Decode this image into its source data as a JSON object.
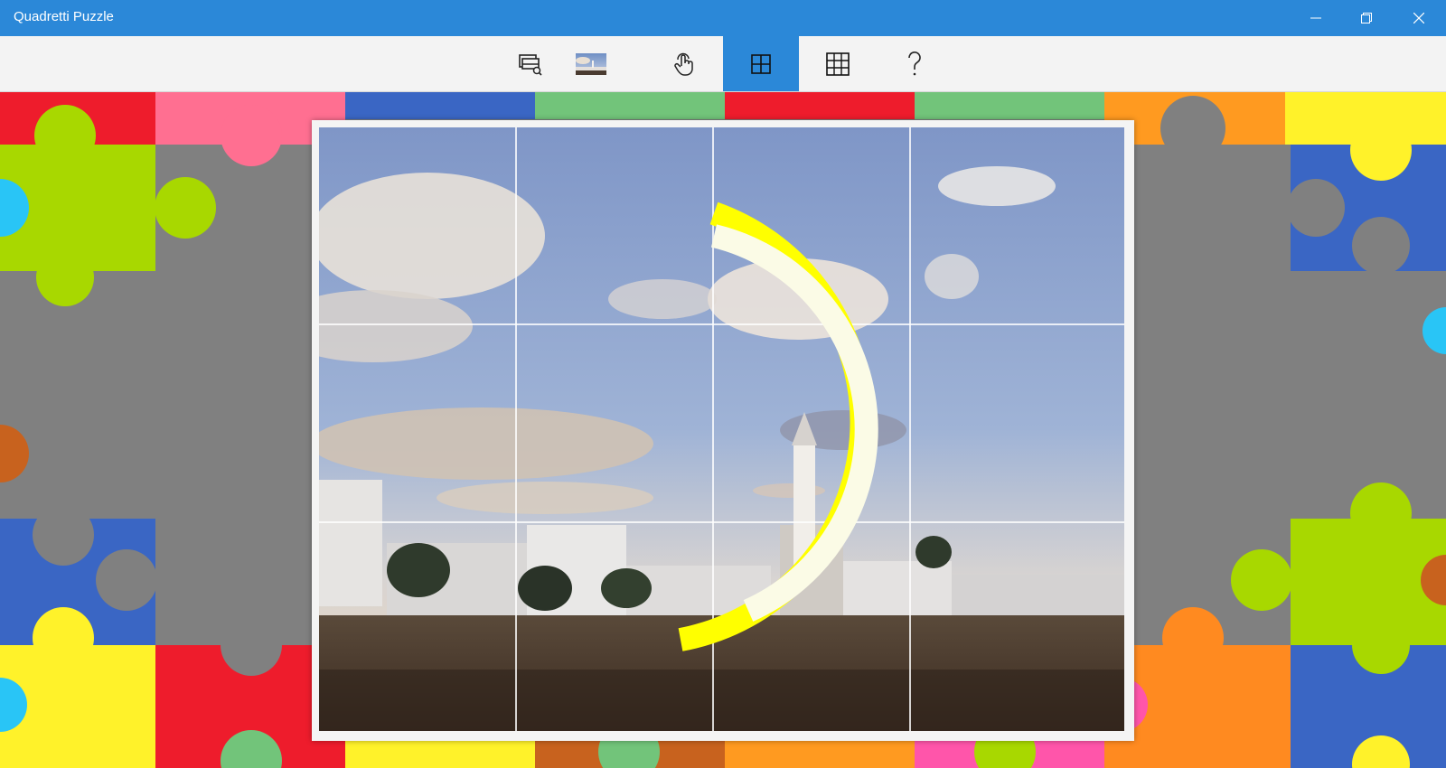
{
  "window": {
    "title": "Quadretti Puzzle",
    "controls": [
      "minimize-icon",
      "restore-icon",
      "close-icon"
    ]
  },
  "toolbar": {
    "buttons": [
      {
        "name": "choose-image-button",
        "icon": "gallery-search-icon",
        "active": false
      },
      {
        "name": "current-image-thumbnail",
        "icon": "image-thumbnail",
        "active": false
      },
      {
        "name": "touch-mode-button",
        "icon": "hand-touch-icon",
        "active": false
      },
      {
        "name": "grid-2x2-button",
        "icon": "grid-2x2-icon",
        "active": true
      },
      {
        "name": "grid-3x3-button",
        "icon": "grid-3x3-icon",
        "active": false
      },
      {
        "name": "help-button",
        "icon": "question-icon",
        "active": false
      }
    ]
  },
  "puzzle": {
    "columns": 4,
    "rows": 3,
    "progress_indicator": "yellow-arc-progress"
  },
  "colors": {
    "titlebar": "#2b88d8",
    "active_tool": "#2b88d8",
    "puzzle_gray": "#808080",
    "puzzle_green": "#a8d800",
    "puzzle_pink": "#ff6f91",
    "puzzle_red": "#ee1c2c",
    "puzzle_blue": "#3a66c4",
    "puzzle_yellow": "#fff22a",
    "puzzle_orange": "#ff8a20",
    "arc_yellow": "#ffff00"
  }
}
